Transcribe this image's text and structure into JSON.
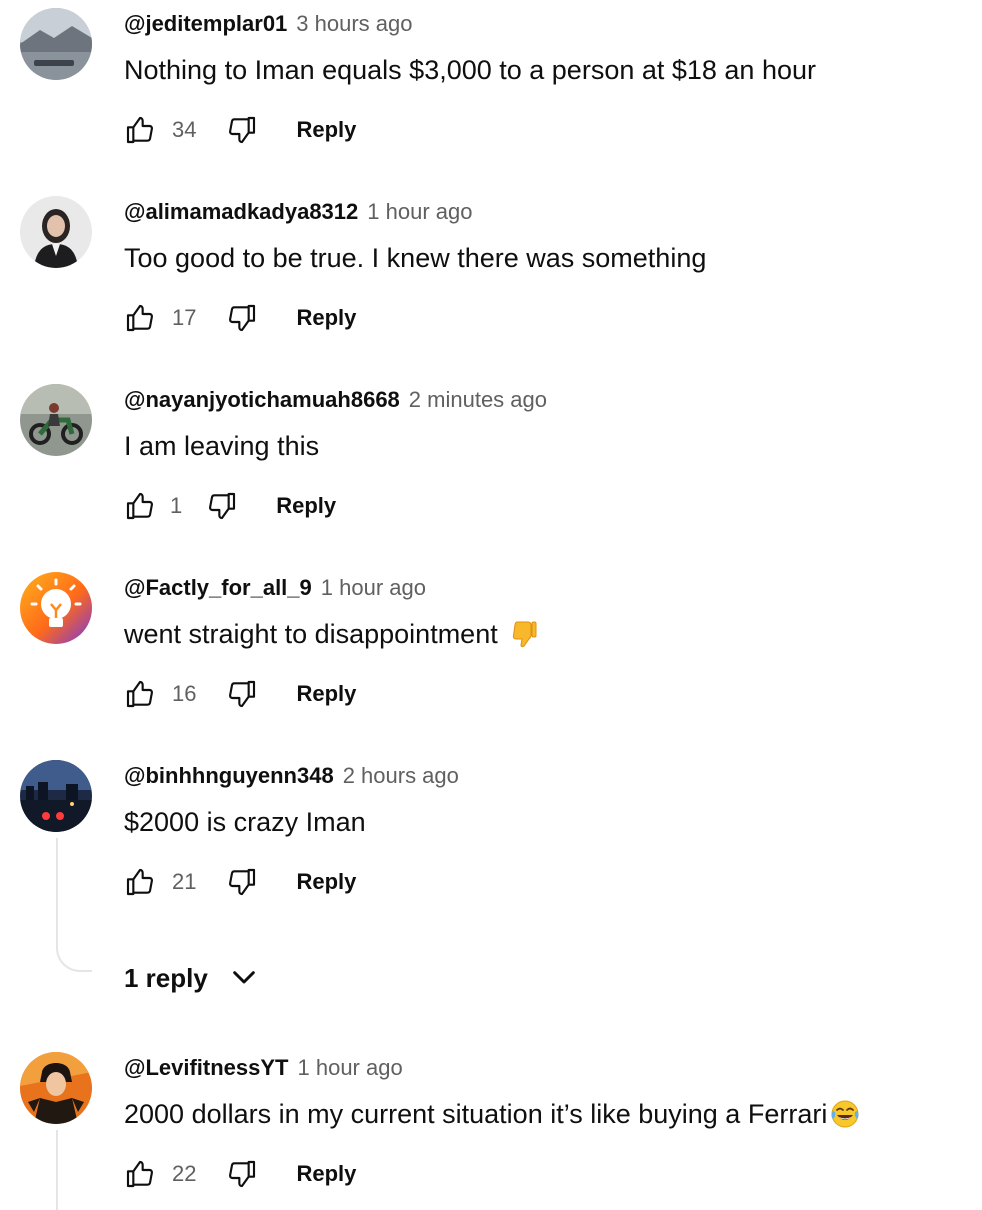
{
  "comments": [
    {
      "author": "@jeditemplar01",
      "time": "3 hours ago",
      "text": "Nothing to Iman equals $3,000 to a person at $18 an hour",
      "likes": "34",
      "reply_label": "Reply"
    },
    {
      "author": "@alimamadkadya8312",
      "time": "1 hour ago",
      "text": "Too good to be true. I knew there was something",
      "likes": "17",
      "reply_label": "Reply"
    },
    {
      "author": "@nayanjyotichamuah8668",
      "time": "2 minutes ago",
      "text": "I am leaving this",
      "likes": "1",
      "reply_label": "Reply"
    },
    {
      "author": "@Factly_for_all_9",
      "time": "1 hour ago",
      "text": "went straight to disappointment",
      "emoji": "thumbs-down-emoji",
      "likes": "16",
      "reply_label": "Reply"
    },
    {
      "author": "@binhhnguyenn348",
      "time": "2 hours ago",
      "text": "$2000 is crazy Iman",
      "likes": "21",
      "reply_label": "Reply",
      "replies_label": "1 reply"
    },
    {
      "author": "@LevifitnessYT",
      "time": "1 hour ago",
      "text": "2000 dollars in my current situation it’s like buying a Ferrari",
      "emoji": "tears-of-joy-emoji",
      "likes": "22",
      "reply_label": "Reply"
    }
  ],
  "icons": {
    "like": "thumb-up-outline-icon",
    "dislike": "thumb-down-outline-icon",
    "expand": "chevron-down-icon"
  },
  "colors": {
    "text": "#0f0f0f",
    "secondary": "#606060",
    "thread_line": "#e5e5e5",
    "emoji_yellow": "#f8b82b"
  }
}
